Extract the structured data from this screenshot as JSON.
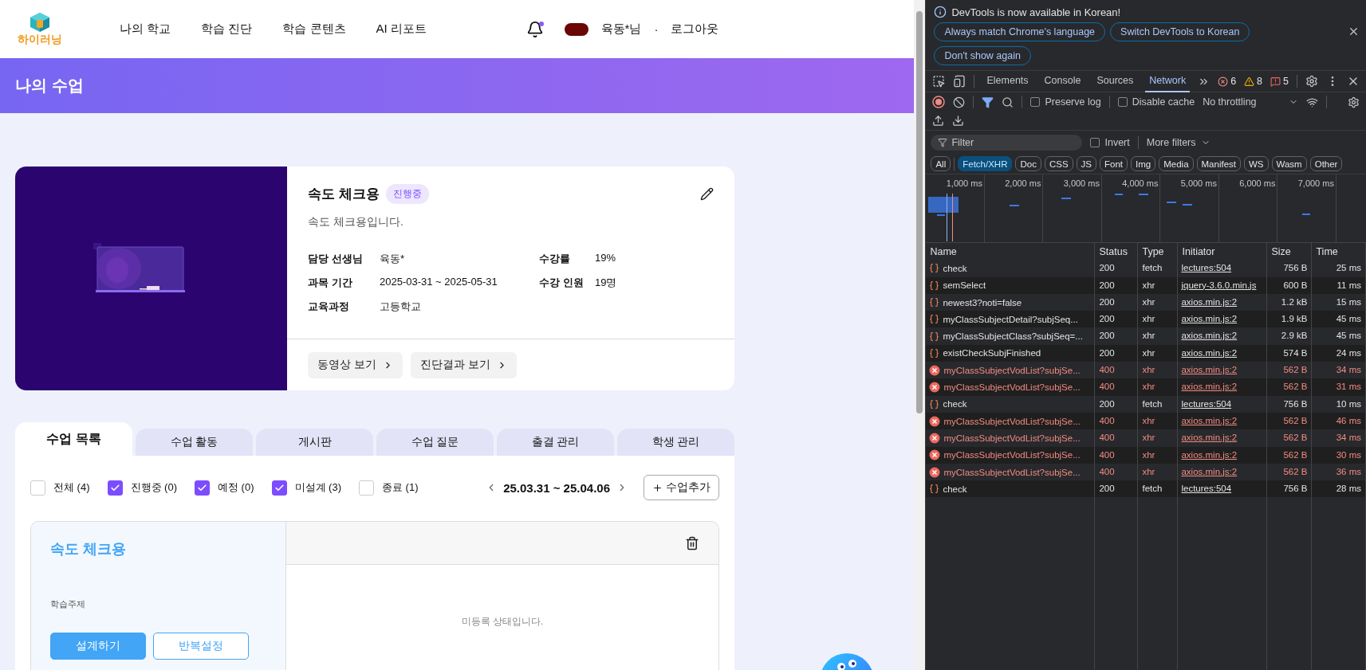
{
  "header": {
    "logo": "하이러닝",
    "nav": [
      {
        "label": "나의 학교"
      },
      {
        "label": "학습 진단"
      },
      {
        "label": "학습 콘텐츠"
      },
      {
        "label": "AI 리포트"
      }
    ],
    "has_unread": true,
    "user": "육동*님",
    "separator": "·",
    "logout": "로그아웃"
  },
  "banner": {
    "title": "나의 수업"
  },
  "class_card": {
    "title": "속도 체크용",
    "status": "진행중",
    "description": "속도 체크용입니다.",
    "info": [
      {
        "label": "담당 선생님",
        "value": "육동*"
      },
      {
        "label": "수강률",
        "value": "19%"
      },
      {
        "label": "과목 기간",
        "value": "2025-03-31 ~ 2025-05-31"
      },
      {
        "label": "수강 인원",
        "value": "19명"
      },
      {
        "label": "교육과정",
        "value": "고등학교"
      }
    ],
    "buttons": [
      "동영상 보기",
      "진단결과 보기"
    ]
  },
  "tabs": [
    {
      "label": "수업 목록",
      "selected": true
    },
    {
      "label": "수업 활동",
      "selected": false
    },
    {
      "label": "게시판",
      "selected": false
    },
    {
      "label": "수업 질문",
      "selected": false
    },
    {
      "label": "출결 관리",
      "selected": false
    },
    {
      "label": "학생 관리",
      "selected": false
    }
  ],
  "filters": [
    {
      "label": "전체 (4)",
      "checked": false
    },
    {
      "label": "진행중 (0)",
      "checked": true
    },
    {
      "label": "예정 (0)",
      "checked": true
    },
    {
      "label": "미설계 (3)",
      "checked": true
    },
    {
      "label": "종료 (1)",
      "checked": false
    }
  ],
  "date_range": "25.03.31 ~ 25.04.06",
  "add_button": "수업추가",
  "lesson": {
    "title": "속도 체크용",
    "topic_label": "학습주제",
    "design_button": "설계하기",
    "repeat_button": "반복설정",
    "empty_text": "미등록 상태입니다."
  },
  "devtools": {
    "notice": "DevTools is now available in Korean!",
    "notice_buttons": [
      "Always match Chrome's language",
      "Switch DevTools to Korean",
      "Don't show again"
    ],
    "tabs": [
      {
        "label": "Elements",
        "selected": false
      },
      {
        "label": "Console",
        "selected": false
      },
      {
        "label": "Sources",
        "selected": false
      },
      {
        "label": "Network",
        "selected": true
      }
    ],
    "counts": [
      {
        "kind": "error",
        "count": "6"
      },
      {
        "kind": "warning",
        "count": "8"
      },
      {
        "kind": "issue",
        "count": "5"
      }
    ],
    "preserve_log": {
      "label": "Preserve log",
      "checked": false
    },
    "disable_cache": {
      "label": "Disable cache",
      "checked": false
    },
    "throttling": "No throttling",
    "filter": {
      "placeholder": "Filter"
    },
    "invert": {
      "label": "Invert",
      "checked": false
    },
    "more_filters": "More filters",
    "chips": [
      {
        "label": "All",
        "selected": false
      },
      {
        "label": "Fetch/XHR",
        "selected": true
      },
      {
        "label": "Doc",
        "selected": false
      },
      {
        "label": "CSS",
        "selected": false
      },
      {
        "label": "JS",
        "selected": false
      },
      {
        "label": "Font",
        "selected": false
      },
      {
        "label": "Img",
        "selected": false
      },
      {
        "label": "Media",
        "selected": false
      },
      {
        "label": "Manifest",
        "selected": false
      },
      {
        "label": "WS",
        "selected": false
      },
      {
        "label": "Wasm",
        "selected": false
      },
      {
        "label": "Other",
        "selected": false
      }
    ],
    "ticks": [
      "1,000 ms",
      "2,000 ms",
      "3,000 ms",
      "4,000 ms",
      "5,000 ms",
      "6,000 ms",
      "7,000 ms"
    ],
    "columns": [
      "Name",
      "Status",
      "Type",
      "Initiator",
      "Size",
      "Time"
    ],
    "rows": [
      {
        "failed": false,
        "name": "check",
        "status": "200",
        "type": "fetch",
        "initiator": "lectures:504",
        "size": "756 B",
        "time": "25 ms"
      },
      {
        "failed": false,
        "name": "semSelect",
        "status": "200",
        "type": "xhr",
        "initiator": "jquery-3.6.0.min.js",
        "size": "600 B",
        "time": "11 ms"
      },
      {
        "failed": false,
        "name": "newest3?noti=false",
        "status": "200",
        "type": "xhr",
        "initiator": "axios.min.js:2",
        "size": "1.2 kB",
        "time": "15 ms"
      },
      {
        "failed": false,
        "name": "myClassSubjectDetail?subjSeq...",
        "status": "200",
        "type": "xhr",
        "initiator": "axios.min.js:2",
        "size": "1.9 kB",
        "time": "45 ms"
      },
      {
        "failed": false,
        "name": "myClassSubjectClass?subjSeq=...",
        "status": "200",
        "type": "xhr",
        "initiator": "axios.min.js:2",
        "size": "2.9 kB",
        "time": "45 ms"
      },
      {
        "failed": false,
        "name": "existCheckSubjFinished",
        "status": "200",
        "type": "xhr",
        "initiator": "axios.min.js:2",
        "size": "574 B",
        "time": "24 ms"
      },
      {
        "failed": true,
        "name": "myClassSubjectVodList?subjSe...",
        "status": "400",
        "type": "xhr",
        "initiator": "axios.min.js:2",
        "size": "562 B",
        "time": "34 ms"
      },
      {
        "failed": true,
        "name": "myClassSubjectVodList?subjSe...",
        "status": "400",
        "type": "xhr",
        "initiator": "axios.min.js:2",
        "size": "562 B",
        "time": "31 ms"
      },
      {
        "failed": false,
        "name": "check",
        "status": "200",
        "type": "fetch",
        "initiator": "lectures:504",
        "size": "756 B",
        "time": "10 ms"
      },
      {
        "failed": true,
        "name": "myClassSubjectVodList?subjSe...",
        "status": "400",
        "type": "xhr",
        "initiator": "axios.min.js:2",
        "size": "562 B",
        "time": "46 ms"
      },
      {
        "failed": true,
        "name": "myClassSubjectVodList?subjSe...",
        "status": "400",
        "type": "xhr",
        "initiator": "axios.min.js:2",
        "size": "562 B",
        "time": "34 ms"
      },
      {
        "failed": true,
        "name": "myClassSubjectVodList?subjSe...",
        "status": "400",
        "type": "xhr",
        "initiator": "axios.min.js:2",
        "size": "562 B",
        "time": "30 ms"
      },
      {
        "failed": true,
        "name": "myClassSubjectVodList?subjSe...",
        "status": "400",
        "type": "xhr",
        "initiator": "axios.min.js:2",
        "size": "562 B",
        "time": "36 ms"
      },
      {
        "failed": false,
        "name": "check",
        "status": "200",
        "type": "fetch",
        "initiator": "lectures:504",
        "size": "756 B",
        "time": "28 ms"
      }
    ]
  }
}
